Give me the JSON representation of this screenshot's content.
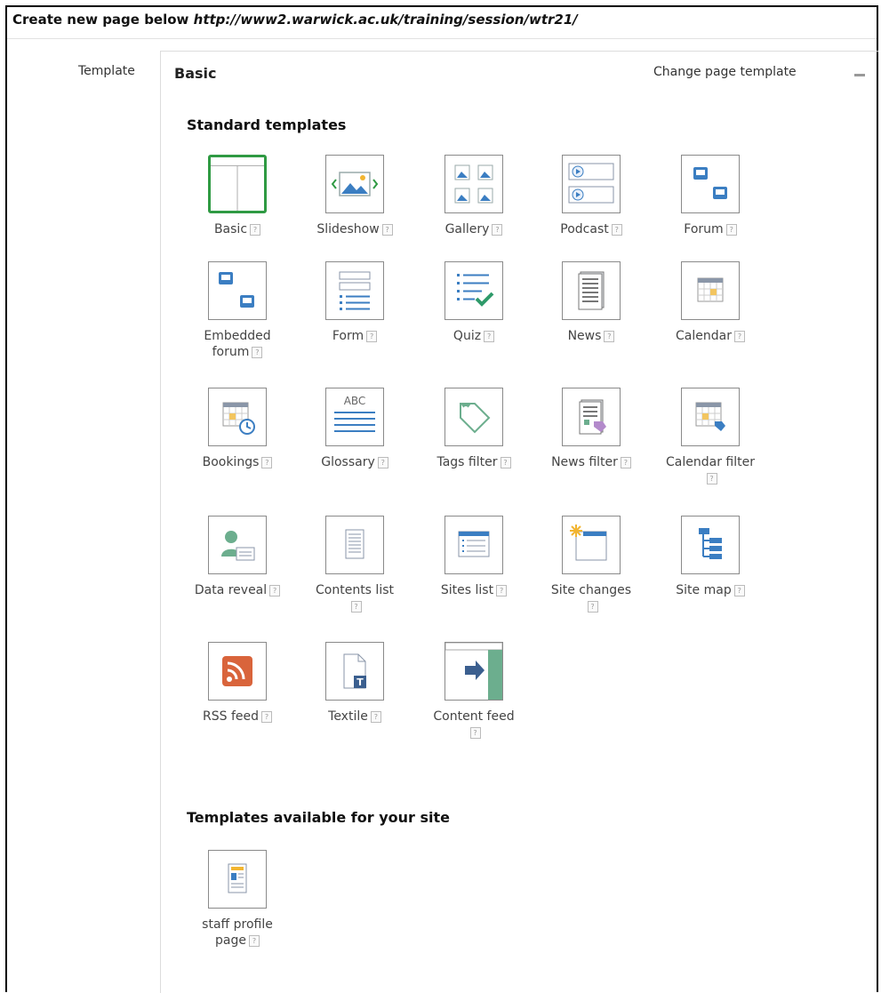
{
  "header": {
    "prefix": "Create new page below",
    "url": "http://www2.warwick.ac.uk/training/session/wtr21/"
  },
  "template_field": {
    "label": "Template",
    "current": "Basic",
    "change_label": "Change page template"
  },
  "standard": {
    "title": "Standard templates",
    "help_glyph": "?",
    "items": [
      {
        "icon": "basic-layout-icon",
        "label": "Basic",
        "selected": true
      },
      {
        "icon": "slideshow-icon",
        "label": "Slideshow"
      },
      {
        "icon": "gallery-icon",
        "label": "Gallery"
      },
      {
        "icon": "podcast-icon",
        "label": "Podcast"
      },
      {
        "icon": "forum-icon",
        "label": "Forum"
      },
      {
        "icon": "embedded-forum-icon",
        "label": "Embedded forum"
      },
      {
        "icon": "form-icon",
        "label": "Form"
      },
      {
        "icon": "quiz-icon",
        "label": "Quiz"
      },
      {
        "icon": "news-icon",
        "label": "News"
      },
      {
        "icon": "calendar-icon",
        "label": "Calendar"
      },
      {
        "icon": "bookings-icon",
        "label": "Bookings"
      },
      {
        "icon": "glossary-icon",
        "label": "Glossary",
        "glyph": "ABC"
      },
      {
        "icon": "tags-filter-icon",
        "label": "Tags filter"
      },
      {
        "icon": "news-filter-icon",
        "label": "News filter"
      },
      {
        "icon": "calendar-filter-icon",
        "label": "Calendar filter"
      },
      {
        "icon": "data-reveal-icon",
        "label": "Data reveal"
      },
      {
        "icon": "contents-list-icon",
        "label": "Contents list"
      },
      {
        "icon": "sites-list-icon",
        "label": "Sites list"
      },
      {
        "icon": "site-changes-icon",
        "label": "Site changes"
      },
      {
        "icon": "site-map-icon",
        "label": "Site map"
      },
      {
        "icon": "rss-feed-icon",
        "label": "RSS feed"
      },
      {
        "icon": "textile-icon",
        "label": "Textile",
        "glyph": "T"
      },
      {
        "icon": "content-feed-icon",
        "label": "Content feed"
      }
    ]
  },
  "site": {
    "title": "Templates available for your site",
    "items": [
      {
        "icon": "staff-profile-page-icon",
        "label": "staff profile page"
      }
    ]
  }
}
